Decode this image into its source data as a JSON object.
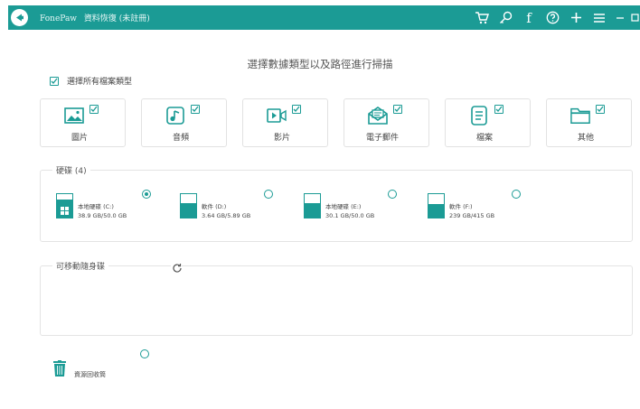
{
  "app": {
    "brand": "FonePaw",
    "title": "資料恢復 (未註冊)",
    "toolbar_icons": [
      "cart-icon",
      "key-icon",
      "facebook-icon",
      "help-icon",
      "plus-icon",
      "menu-icon",
      "minimize-icon",
      "maximize-icon"
    ]
  },
  "headline": "選擇數據類型以及路徑進行掃描",
  "select_all": {
    "label": "選擇所有檔案類型",
    "checked": true
  },
  "file_types": [
    {
      "label": "圖片",
      "icon": "image-icon",
      "checked": true
    },
    {
      "label": "音頻",
      "icon": "music-icon",
      "checked": true
    },
    {
      "label": "影片",
      "icon": "video-icon",
      "checked": true
    },
    {
      "label": "電子郵件",
      "icon": "email-icon",
      "checked": true
    },
    {
      "label": "檔案",
      "icon": "document-icon",
      "checked": true
    },
    {
      "label": "其他",
      "icon": "folder-icon",
      "checked": true
    }
  ],
  "disks": {
    "label": "硬碟 (4)",
    "items": [
      {
        "name": "本地硬碟 (C:)",
        "size": "38.9 GB/50.0 GB",
        "used_fraction": 0.78,
        "selected": true,
        "windows": true
      },
      {
        "name": "軟件 (D:)",
        "size": "3.64 GB/5.89 GB",
        "used_fraction": 0.62,
        "selected": false,
        "windows": false
      },
      {
        "name": "本地硬碟 (E:)",
        "size": "30.1 GB/50.0 GB",
        "used_fraction": 0.6,
        "selected": false,
        "windows": false
      },
      {
        "name": "軟件 (F:)",
        "size": "239 GB/415 GB",
        "used_fraction": 0.58,
        "selected": false,
        "windows": false
      }
    ]
  },
  "removable": {
    "label": "可移動隨身碟"
  },
  "recycle_bin": {
    "label": "資源回收筒",
    "selected": false
  },
  "colors": {
    "accent": "#1b9b95"
  }
}
